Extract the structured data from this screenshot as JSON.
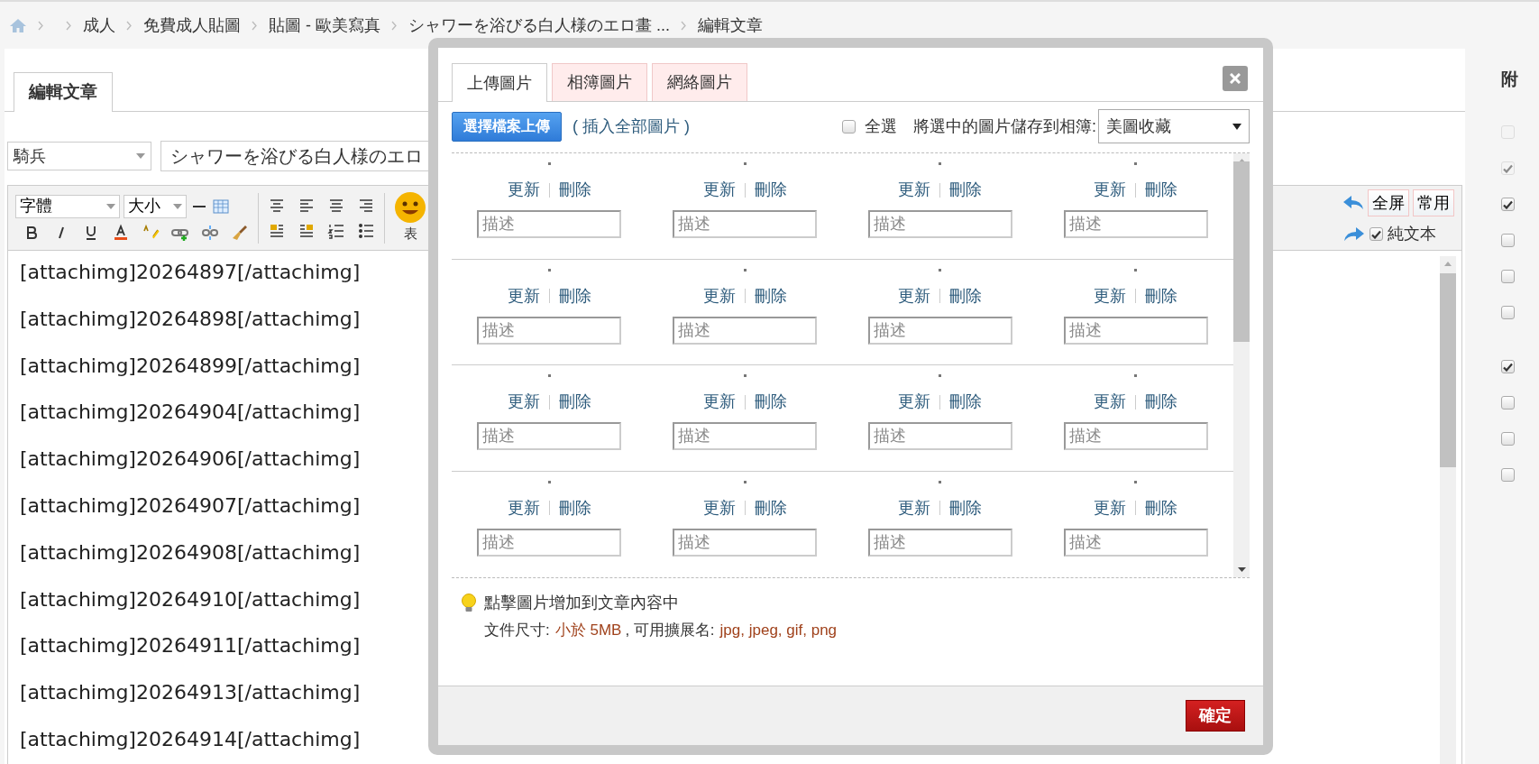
{
  "breadcrumb": [
    {
      "kind": "home"
    },
    {
      "kind": "empty"
    },
    {
      "kind": "link",
      "label": "成人"
    },
    {
      "kind": "link",
      "label": "免費成人貼圖"
    },
    {
      "kind": "link",
      "label": "貼圖 - 歐美寫真"
    },
    {
      "kind": "link",
      "label": "シャワーを浴びる白人様のエロ畫 ..."
    },
    {
      "kind": "current",
      "label": "編輯文章"
    }
  ],
  "editor": {
    "tab": "編輯文章",
    "category": "騎兵",
    "title_value": "シャワーを浴びる白人様のエロ",
    "font_select": "字體",
    "size_select": "大小",
    "emoticon_label": "表",
    "fullscreen": "全屏",
    "common": "常用",
    "plain_text": {
      "label": "純文本",
      "checked": true
    },
    "lines": [
      "[attachimg]20264897[/attachimg]",
      "[attachimg]20264898[/attachimg]",
      "[attachimg]20264899[/attachimg]",
      "[attachimg]20264904[/attachimg]",
      "[attachimg]20264906[/attachimg]",
      "[attachimg]20264907[/attachimg]",
      "[attachimg]20264908[/attachimg]",
      "[attachimg]20264910[/attachimg]",
      "[attachimg]20264911[/attachimg]",
      "[attachimg]20264913[/attachimg]",
      "[attachimg]20264914[/attachimg]"
    ]
  },
  "side_panel": {
    "heading": "附",
    "checkboxes": [
      {
        "checked": false,
        "disabled": true
      },
      {
        "checked": true,
        "disabled": true
      },
      {
        "checked": true,
        "disabled": false
      },
      {
        "checked": false,
        "disabled": false
      },
      {
        "checked": false,
        "disabled": false
      },
      {
        "checked": false,
        "disabled": false
      },
      {
        "checked": true,
        "disabled": false
      },
      {
        "checked": false,
        "disabled": false
      },
      {
        "checked": false,
        "disabled": false
      },
      {
        "checked": false,
        "disabled": false
      }
    ]
  },
  "modal": {
    "tabs": [
      {
        "label": "上傳圖片",
        "selected": true
      },
      {
        "label": "相簿圖片",
        "selected": false
      },
      {
        "label": "網絡圖片",
        "selected": false
      }
    ],
    "upload_button": "選擇檔案上傳",
    "insert_all": "( 插入全部圖片 )",
    "select_all": {
      "label": "全選",
      "checked": false
    },
    "save_label": "將選中的圖片儲存到相簿:",
    "album": "美圖收藏",
    "rows": [
      [
        {
          "update": "更新",
          "delete": "刪除",
          "placeholder": "描述"
        },
        {
          "update": "更新",
          "delete": "刪除",
          "placeholder": "描述"
        },
        {
          "update": "更新",
          "delete": "刪除",
          "placeholder": "描述"
        },
        {
          "update": "更新",
          "delete": "刪除",
          "placeholder": "描述"
        }
      ],
      [
        {
          "update": "更新",
          "delete": "刪除",
          "placeholder": "描述"
        },
        {
          "update": "更新",
          "delete": "刪除",
          "placeholder": "描述"
        },
        {
          "update": "更新",
          "delete": "刪除",
          "placeholder": "描述"
        },
        {
          "update": "更新",
          "delete": "刪除",
          "placeholder": "描述"
        }
      ],
      [
        {
          "update": "更新",
          "delete": "刪除",
          "placeholder": "描述"
        },
        {
          "update": "更新",
          "delete": "刪除",
          "placeholder": "描述"
        },
        {
          "update": "更新",
          "delete": "刪除",
          "placeholder": "描述"
        },
        {
          "update": "更新",
          "delete": "刪除",
          "placeholder": "描述"
        }
      ],
      [
        {
          "update": "更新",
          "delete": "刪除",
          "placeholder": "描述"
        },
        {
          "update": "更新",
          "delete": "刪除",
          "placeholder": "描述"
        },
        {
          "update": "更新",
          "delete": "刪除",
          "placeholder": "描述"
        },
        {
          "update": "更新",
          "delete": "刪除",
          "placeholder": "描述"
        }
      ]
    ],
    "tip": "點擊圖片增加到文章內容中",
    "size_label": "文件尺寸:",
    "size_value": "小於 5MB",
    "ext_label": ", 可用擴展名:",
    "ext_value": "jpg, jpeg, gif, png",
    "confirm": "確定"
  }
}
